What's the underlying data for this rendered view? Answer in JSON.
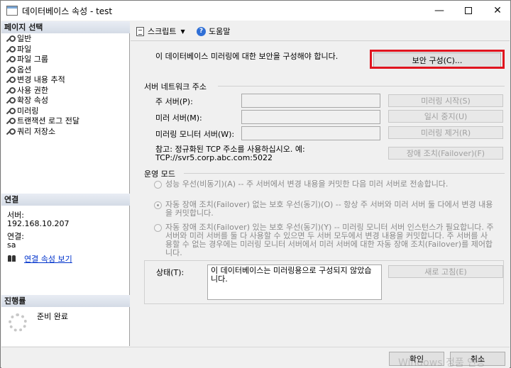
{
  "window": {
    "title": "데이터베이스 속성 - test",
    "minimize_glyph": "—",
    "close_glyph": "✕"
  },
  "left_pane": {
    "page_select_header": "페이지 선택",
    "pages": [
      {
        "label": "일반"
      },
      {
        "label": "파일"
      },
      {
        "label": "파일 그룹"
      },
      {
        "label": "옵션"
      },
      {
        "label": "변경 내용 추적"
      },
      {
        "label": "사용 권한"
      },
      {
        "label": "확장 속성"
      },
      {
        "label": "미러링"
      },
      {
        "label": "트랜잭션 로그 전달"
      },
      {
        "label": "쿼리 저장소"
      }
    ],
    "connection_header": "연결",
    "server_label": "서버:",
    "server_value": "192.168.10.207",
    "connection_label": "연결:",
    "connection_value": "sa",
    "connection_properties_link": "연결 속성 보기",
    "progress_header": "진행률",
    "progress_status": "준비 완료"
  },
  "toolbar": {
    "script_label": "스크립트",
    "help_label": "도움말"
  },
  "mirroring": {
    "notice": "이 데이터베이스 미러링에 대한 보안을 구성해야 합니다.",
    "configure_security_button": "보안 구성(C)...",
    "server_network_group": "서버 네트워크 주소",
    "principal_label": "주 서버(P):",
    "mirror_label": "미러 서버(M):",
    "witness_label": "미러링 모니터 서버(W):",
    "principal_value": "",
    "mirror_value": "",
    "witness_value": "",
    "start_mirroring_button": "미러링 시작(S)",
    "pause_button": "일시 중지(U)",
    "remove_mirroring_button": "미러링 제거(R)",
    "failover_button": "장애 조치(Failover)(F)",
    "note_line1": "참고: 정규화된 TCP 주소를 사용하십시오. 예:",
    "note_line2": "TCP://svr5.corp.abc.com:5022",
    "operating_mode_group": "운영 모드",
    "modes": [
      {
        "text": "성능 우선(비동기)(A) -- 주 서버에서 변경 내용을 커밋한 다음 미러 서버로 전송합니다.",
        "checked": false
      },
      {
        "text": "자동 장애 조치(Failover) 없는 보호 우선(동기)(O) -- 항상 주 서버와 미러 서버 둘 다에서 변경 내용을 커밋합니다.",
        "checked": true
      },
      {
        "text": "자동 장애 조치(Failover) 있는 보호 우선(동기)(Y) -- 미러링 모니터 서버 인스턴스가 필요합니다. 주 서버와 미러 서버를 둘 다 사용할 수 있으면 두 서버 모두에서 변경 내용을 커밋합니다. 주 서버를 사용할 수 없는 경우에는 미러링 모니터 서버에서 미러 서버에 대한 자동 장애 조치(Failover)를 제어합니다.",
        "checked": false
      }
    ],
    "status_label": "상태(T):",
    "status_text": "이 데이터베이스는 미러링용으로 구성되지 않았습니다.",
    "refresh_button": "새로 고침(E)"
  },
  "footer": {
    "ok_button": "확인",
    "cancel_button": "취소",
    "watermark": "Windows 정품 인증"
  },
  "colors": {
    "highlight": "#e0141e",
    "link": "#0033cc"
  }
}
